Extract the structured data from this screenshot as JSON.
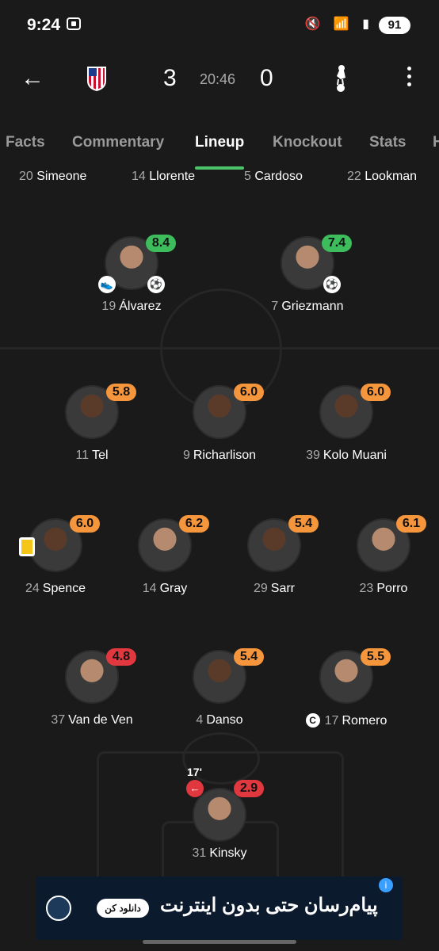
{
  "status": {
    "time": "9:24",
    "battery": "91",
    "icons": "🔇 📶 ▮"
  },
  "match": {
    "home_score": "3",
    "away_score": "0",
    "clock": "20:46",
    "back_icon": "←"
  },
  "tabs": [
    "Facts",
    "Commentary",
    "Lineup",
    "Knockout",
    "Stats",
    "H"
  ],
  "active_tab": "Lineup",
  "subs_row": [
    {
      "num": "20",
      "name": "Simeone"
    },
    {
      "num": "14",
      "name": "Llorente"
    },
    {
      "num": "5",
      "name": "Cardoso"
    },
    {
      "num": "22",
      "name": "Lookman"
    }
  ],
  "players": {
    "alvarez": {
      "num": "19",
      "name": "Álvarez",
      "rating": "8.4"
    },
    "griezmann": {
      "num": "7",
      "name": "Griezmann",
      "rating": "7.4"
    },
    "tel": {
      "num": "11",
      "name": "Tel",
      "rating": "5.8"
    },
    "richarlison": {
      "num": "9",
      "name": "Richarlison",
      "rating": "6.0"
    },
    "kolo": {
      "num": "39",
      "name": "Kolo Muani",
      "rating": "6.0"
    },
    "spence": {
      "num": "24",
      "name": "Spence",
      "rating": "6.0"
    },
    "gray": {
      "num": "14",
      "name": "Gray",
      "rating": "6.2"
    },
    "sarr": {
      "num": "29",
      "name": "Sarr",
      "rating": "5.4"
    },
    "porro": {
      "num": "23",
      "name": "Porro",
      "rating": "6.1"
    },
    "vandeven": {
      "num": "37",
      "name": "Van de Ven",
      "rating": "4.8"
    },
    "danso": {
      "num": "4",
      "name": "Danso",
      "rating": "5.4"
    },
    "romero": {
      "num": "17",
      "name": "Romero",
      "rating": "5.5",
      "captain": "C"
    },
    "kinsky": {
      "num": "31",
      "name": "Kinsky",
      "rating": "2.9",
      "sub_minute": "17'"
    }
  },
  "colors": {
    "green": "#3dbd5c",
    "orange": "#f5963c",
    "red": "#e0383e"
  },
  "ad": {
    "button": "دانلود کن",
    "text": "پیام‌رسان حتی بدون اینترنت"
  }
}
